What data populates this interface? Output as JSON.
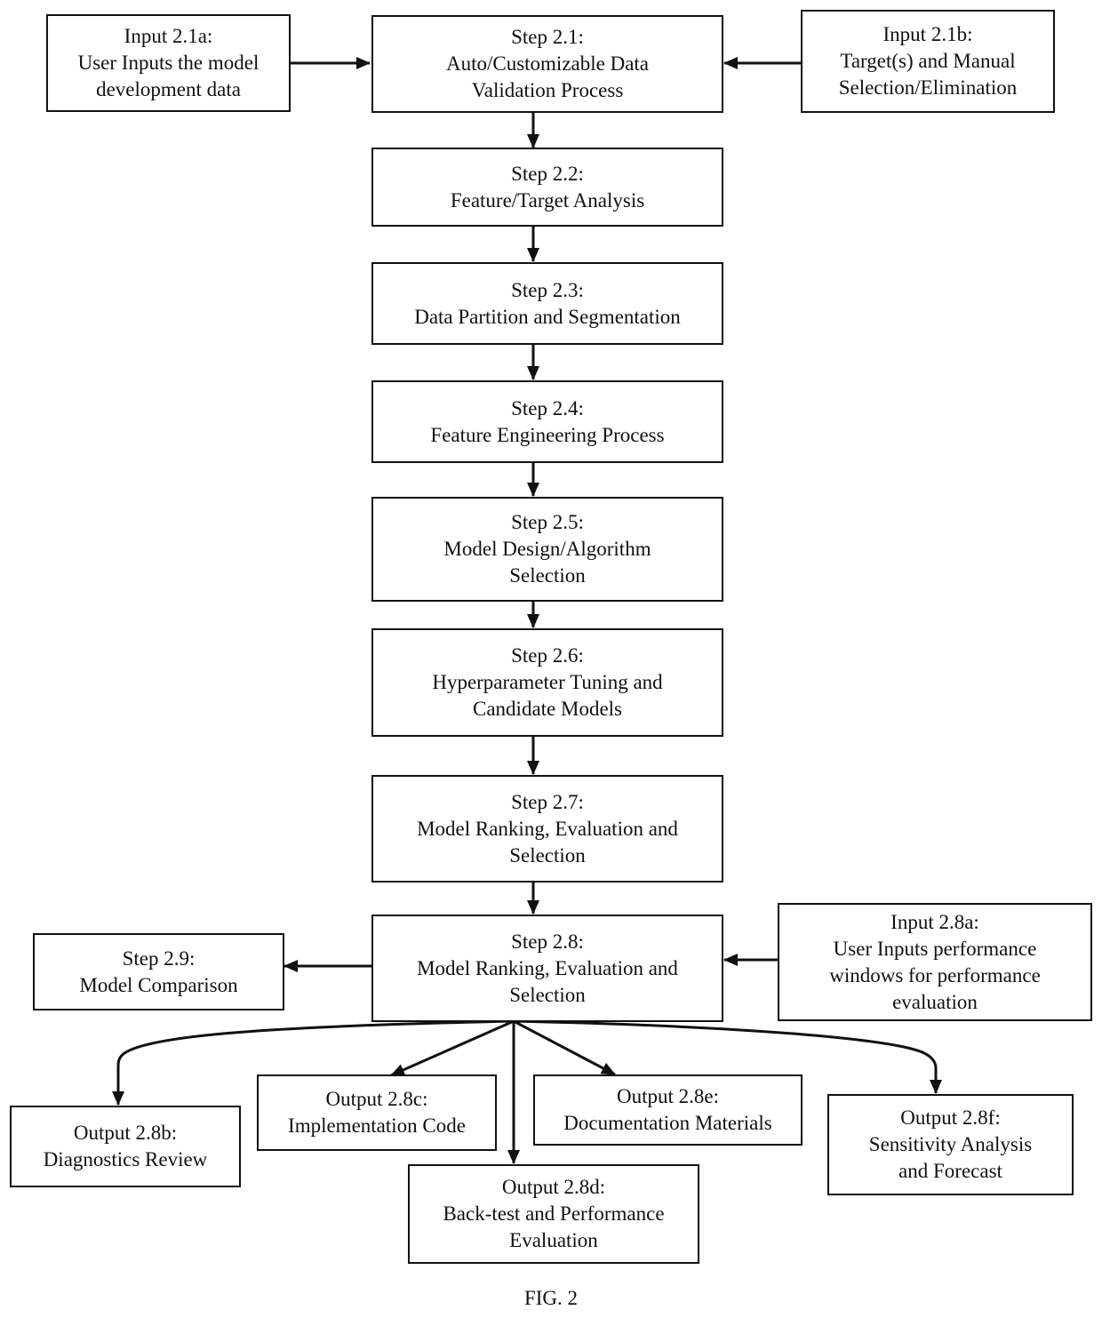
{
  "figure": {
    "caption": "FIG. 2",
    "nodes": {
      "input_2_1a": {
        "title": "Input 2.1a:",
        "lines": [
          "User Inputs the model",
          "development data"
        ]
      },
      "step_2_1": {
        "title": "Step 2.1:",
        "lines": [
          "Auto/Customizable Data",
          "Validation Process"
        ]
      },
      "input_2_1b": {
        "title": "Input 2.1b:",
        "lines": [
          "Target(s) and Manual",
          "Selection/Elimination"
        ]
      },
      "step_2_2": {
        "title": "Step 2.2:",
        "lines": [
          "Feature/Target Analysis"
        ]
      },
      "step_2_3": {
        "title": "Step 2.3:",
        "lines": [
          "Data Partition and Segmentation"
        ]
      },
      "step_2_4": {
        "title": "Step 2.4:",
        "lines": [
          "Feature Engineering Process"
        ]
      },
      "step_2_5": {
        "title": "Step 2.5:",
        "lines": [
          "Model Design/Algorithm",
          "Selection"
        ]
      },
      "step_2_6": {
        "title": "Step 2.6:",
        "lines": [
          "Hyperparameter Tuning and",
          "Candidate Models"
        ]
      },
      "step_2_7": {
        "title": "Step 2.7:",
        "lines": [
          "Model Ranking, Evaluation and",
          "Selection"
        ]
      },
      "step_2_8": {
        "title": "Step 2.8:",
        "lines": [
          "Model Ranking, Evaluation and",
          "Selection"
        ]
      },
      "step_2_9": {
        "title": "Step 2.9:",
        "lines": [
          "Model Comparison"
        ]
      },
      "input_2_8a": {
        "title": "Input 2.8a:",
        "lines": [
          "User Inputs performance",
          "windows for performance",
          "evaluation"
        ]
      },
      "output_2_8b": {
        "title": "Output 2.8b:",
        "lines": [
          "Diagnostics Review"
        ]
      },
      "output_2_8c": {
        "title": "Output 2.8c:",
        "lines": [
          "Implementation Code"
        ]
      },
      "output_2_8d": {
        "title": "Output 2.8d:",
        "lines": [
          "Back-test and Performance",
          "Evaluation"
        ]
      },
      "output_2_8e": {
        "title": "Output 2.8e:",
        "lines": [
          "Documentation Materials"
        ]
      },
      "output_2_8f": {
        "title": "Output 2.8f:",
        "lines": [
          "Sensitivity Analysis",
          "and Forecast"
        ]
      }
    },
    "edges": [
      {
        "from": "input_2_1a",
        "to": "step_2_1"
      },
      {
        "from": "input_2_1b",
        "to": "step_2_1"
      },
      {
        "from": "step_2_1",
        "to": "step_2_2"
      },
      {
        "from": "step_2_2",
        "to": "step_2_3"
      },
      {
        "from": "step_2_3",
        "to": "step_2_4"
      },
      {
        "from": "step_2_4",
        "to": "step_2_5"
      },
      {
        "from": "step_2_5",
        "to": "step_2_6"
      },
      {
        "from": "step_2_6",
        "to": "step_2_7"
      },
      {
        "from": "step_2_7",
        "to": "step_2_8"
      },
      {
        "from": "step_2_8",
        "to": "step_2_9"
      },
      {
        "from": "input_2_8a",
        "to": "step_2_8"
      },
      {
        "from": "step_2_8",
        "to": "output_2_8b"
      },
      {
        "from": "step_2_8",
        "to": "output_2_8c"
      },
      {
        "from": "step_2_8",
        "to": "output_2_8d"
      },
      {
        "from": "step_2_8",
        "to": "output_2_8e"
      },
      {
        "from": "step_2_8",
        "to": "output_2_8f"
      }
    ]
  }
}
